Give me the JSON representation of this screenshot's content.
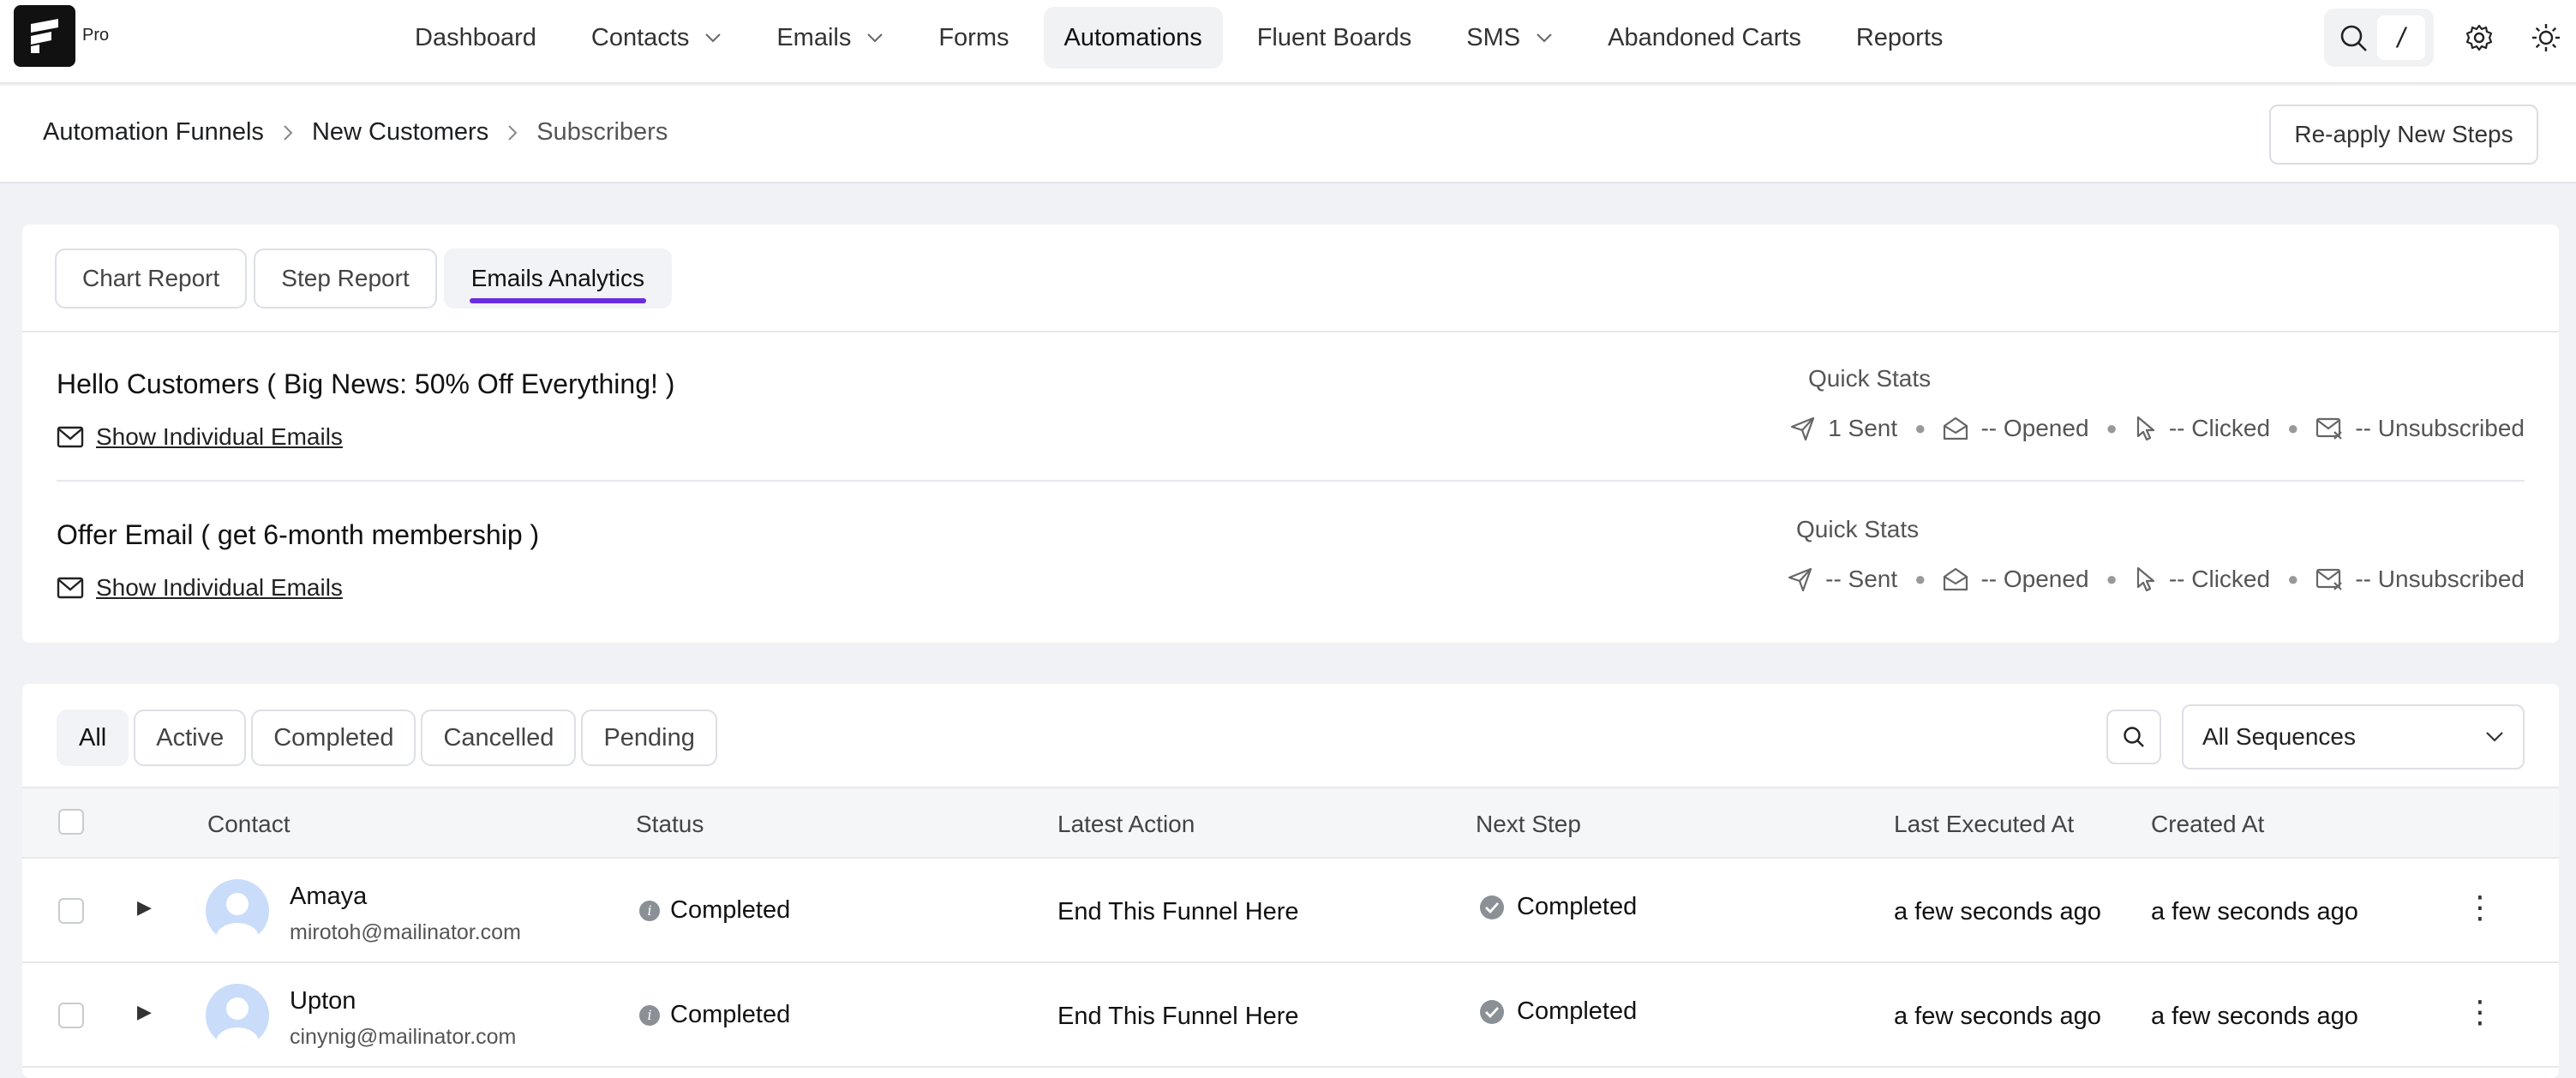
{
  "app": {
    "badge": "Pro"
  },
  "nav": {
    "items": [
      {
        "label": "Dashboard",
        "dropdown": false,
        "active": false
      },
      {
        "label": "Contacts",
        "dropdown": true,
        "active": false
      },
      {
        "label": "Emails",
        "dropdown": true,
        "active": false
      },
      {
        "label": "Forms",
        "dropdown": false,
        "active": false
      },
      {
        "label": "Automations",
        "dropdown": false,
        "active": true
      },
      {
        "label": "Fluent Boards",
        "dropdown": false,
        "active": false
      },
      {
        "label": "SMS",
        "dropdown": true,
        "active": false
      },
      {
        "label": "Abandoned Carts",
        "dropdown": false,
        "active": false
      },
      {
        "label": "Reports",
        "dropdown": false,
        "active": false
      }
    ],
    "shortcut_key": "/",
    "icons": [
      "search-icon",
      "gear-icon",
      "sun-icon"
    ]
  },
  "breadcrumb": {
    "items": [
      "Automation Funnels",
      "New Customers",
      "Subscribers"
    ],
    "reapply_label": "Re-apply New Steps"
  },
  "report": {
    "tabs": [
      "Chart Report",
      "Step Report",
      "Emails Analytics"
    ],
    "active_tab": "Emails Analytics",
    "emails": [
      {
        "title": "Hello Customers ( Big News: 50% Off Everything! )",
        "link": "Show Individual Emails",
        "quick_stats_label": "Quick Stats",
        "sent": "1 Sent",
        "opened": "-- Opened",
        "clicked": "-- Clicked",
        "unsubscribed": "-- Unsubscribed"
      },
      {
        "title": "Offer Email ( get 6-month membership )",
        "link": "Show Individual Emails",
        "quick_stats_label": "Quick Stats",
        "sent": "-- Sent",
        "opened": "-- Opened",
        "clicked": "-- Clicked",
        "unsubscribed": "-- Unsubscribed"
      }
    ]
  },
  "subscribers": {
    "filters": [
      "All",
      "Active",
      "Completed",
      "Cancelled",
      "Pending"
    ],
    "active_filter": "All",
    "sequence_select": "All Sequences",
    "columns": [
      "Contact",
      "Status",
      "Latest Action",
      "Next Step",
      "Last Executed At",
      "Created At"
    ],
    "rows": [
      {
        "name": "Amaya",
        "email": "mirotoh@mailinator.com",
        "status": "Completed",
        "latest_action": "End This Funnel Here",
        "next_step": "Completed",
        "last_executed": "a few seconds ago",
        "created": "a few seconds ago"
      },
      {
        "name": "Upton",
        "email": "cinynig@mailinator.com",
        "status": "Completed",
        "latest_action": "End This Funnel Here",
        "next_step": "Completed",
        "last_executed": "a few seconds ago",
        "created": "a few seconds ago"
      }
    ]
  },
  "colors": {
    "accent": "#6a2ce0",
    "nav_active_bg": "#f1f2f4"
  }
}
